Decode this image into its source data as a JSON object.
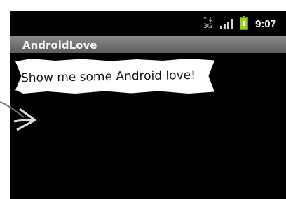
{
  "status_bar": {
    "network_type": "3G",
    "network_arrows": "↑↓",
    "time": "9:07"
  },
  "app_bar": {
    "title": "AndroidLove"
  },
  "content": {
    "message": "Show me some Android love!"
  }
}
